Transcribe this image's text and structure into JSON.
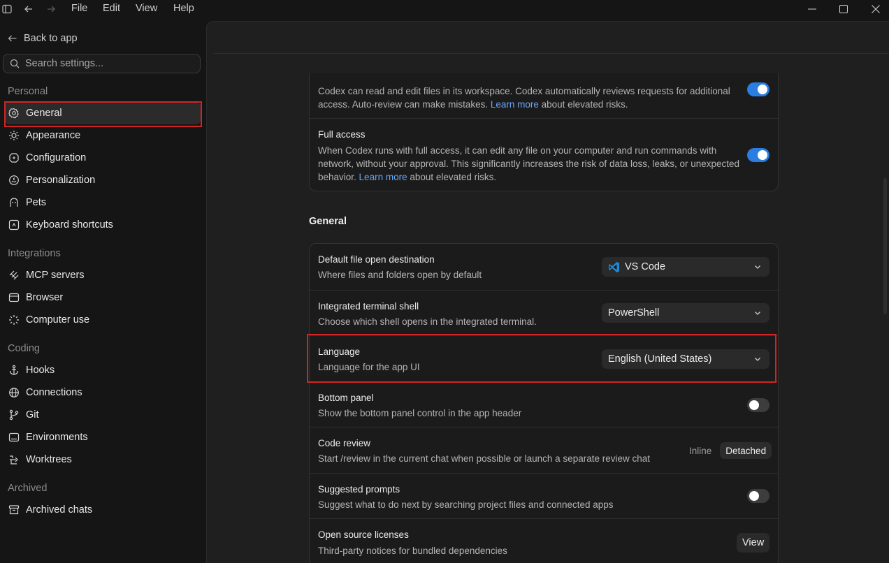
{
  "menu": {
    "items": [
      "File",
      "Edit",
      "View",
      "Help"
    ]
  },
  "sidebar": {
    "back_label": "Back to app",
    "search_placeholder": "Search settings...",
    "sections": [
      {
        "label": "Personal",
        "items": [
          {
            "label": "General",
            "icon": "gear-icon",
            "active": true
          },
          {
            "label": "Appearance",
            "icon": "sun-icon"
          },
          {
            "label": "Configuration",
            "icon": "config-icon"
          },
          {
            "label": "Personalization",
            "icon": "personalization-icon"
          },
          {
            "label": "Pets",
            "icon": "pet-icon"
          },
          {
            "label": "Keyboard shortcuts",
            "icon": "keyboard-icon"
          }
        ]
      },
      {
        "label": "Integrations",
        "items": [
          {
            "label": "MCP servers",
            "icon": "mcp-icon"
          },
          {
            "label": "Browser",
            "icon": "browser-icon"
          },
          {
            "label": "Computer use",
            "icon": "computer-use-icon"
          }
        ]
      },
      {
        "label": "Coding",
        "items": [
          {
            "label": "Hooks",
            "icon": "anchor-icon"
          },
          {
            "label": "Connections",
            "icon": "globe-icon"
          },
          {
            "label": "Git",
            "icon": "git-branch-icon"
          },
          {
            "label": "Environments",
            "icon": "environment-icon"
          },
          {
            "label": "Worktrees",
            "icon": "worktree-icon"
          }
        ]
      },
      {
        "label": "Archived",
        "items": [
          {
            "label": "Archived chats",
            "icon": "archive-icon"
          }
        ]
      }
    ]
  },
  "permissions": {
    "auto_review_desc_1": "Codex can read and edit files in its workspace. Codex automatically reviews requests for additional",
    "auto_review_desc_2_pre": "access. Auto-review can make mistakes. ",
    "auto_review_link": "Learn more",
    "auto_review_desc_2_post": " about elevated risks.",
    "auto_review_on": true,
    "full_access_title": "Full access",
    "full_access_desc_1": "When Codex runs with full access, it can edit any file on your computer and run commands with",
    "full_access_desc_2": "network, without your approval. This significantly increases the risk of data loss, leaks, or unexpected",
    "full_access_desc_3_pre": "behavior. ",
    "full_access_link": "Learn more",
    "full_access_desc_3_post": " about elevated risks.",
    "full_access_on": true
  },
  "general": {
    "heading": "General",
    "default_open": {
      "title": "Default file open destination",
      "desc": "Where files and folders open by default",
      "value": "VS Code",
      "icon": "vscode-icon"
    },
    "terminal": {
      "title": "Integrated terminal shell",
      "desc": "Choose which shell opens in the integrated terminal.",
      "value": "PowerShell"
    },
    "language": {
      "title": "Language",
      "desc": "Language for the app UI",
      "value": "English (United States)"
    },
    "bottom_panel": {
      "title": "Bottom panel",
      "desc": "Show the bottom panel control in the app header",
      "on": false
    },
    "code_review": {
      "title": "Code review",
      "desc": "Start /review in the current chat when possible or launch a separate review chat",
      "options": [
        "Inline",
        "Detached"
      ],
      "selected": "Detached"
    },
    "suggested_prompts": {
      "title": "Suggested prompts",
      "desc": "Suggest what to do next by searching project files and connected apps",
      "on": false
    },
    "licenses": {
      "title": "Open source licenses",
      "desc": "Third-party notices for bundled dependencies",
      "button": "View"
    }
  },
  "colors": {
    "accent": "#2a7de1",
    "link": "#6aa6f5",
    "highlight": "#d32424"
  }
}
